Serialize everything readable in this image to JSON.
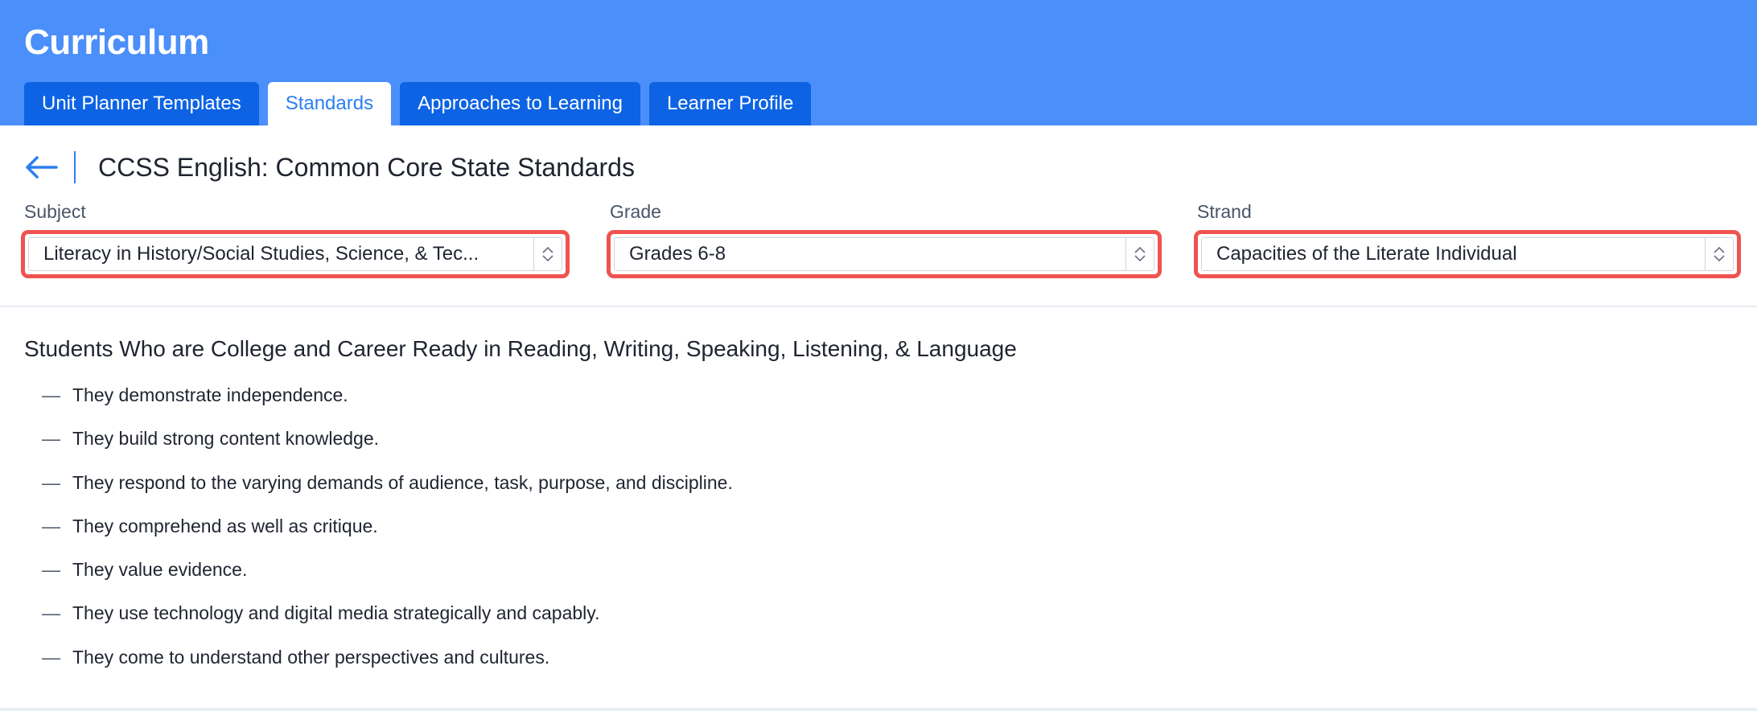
{
  "app": {
    "title": "Curriculum"
  },
  "tabs": [
    {
      "label": "Unit Planner Templates",
      "active": false
    },
    {
      "label": "Standards",
      "active": true
    },
    {
      "label": "Approaches to Learning",
      "active": false
    },
    {
      "label": "Learner Profile",
      "active": false
    }
  ],
  "page": {
    "title": "CCSS English: Common Core State Standards"
  },
  "filters": {
    "subject": {
      "label": "Subject",
      "value": "Literacy in History/Social Studies, Science, & Tec..."
    },
    "grade": {
      "label": "Grade",
      "value": "Grades 6-8"
    },
    "strand": {
      "label": "Strand",
      "value": "Capacities of the Literate Individual"
    }
  },
  "section": {
    "title": "Students Who are College and Career Ready in Reading, Writing, Speaking, Listening, & Language",
    "dash": "—",
    "items": [
      "They demonstrate independence.",
      "They build strong content knowledge.",
      "They respond to the varying demands of audience, task, purpose, and discipline.",
      "They comprehend as well as critique.",
      "They value evidence.",
      "They use technology and digital media strategically and capably.",
      "They come to understand other perspectives and cultures."
    ]
  },
  "icons": {
    "back": "arrow-left-icon",
    "stepper": "chevron-up-down-icon"
  },
  "colors": {
    "header": "#4b8ffa",
    "tab": "#0d63e4",
    "tab_active_text": "#2a7ff0",
    "highlight_border": "#ef5350"
  }
}
